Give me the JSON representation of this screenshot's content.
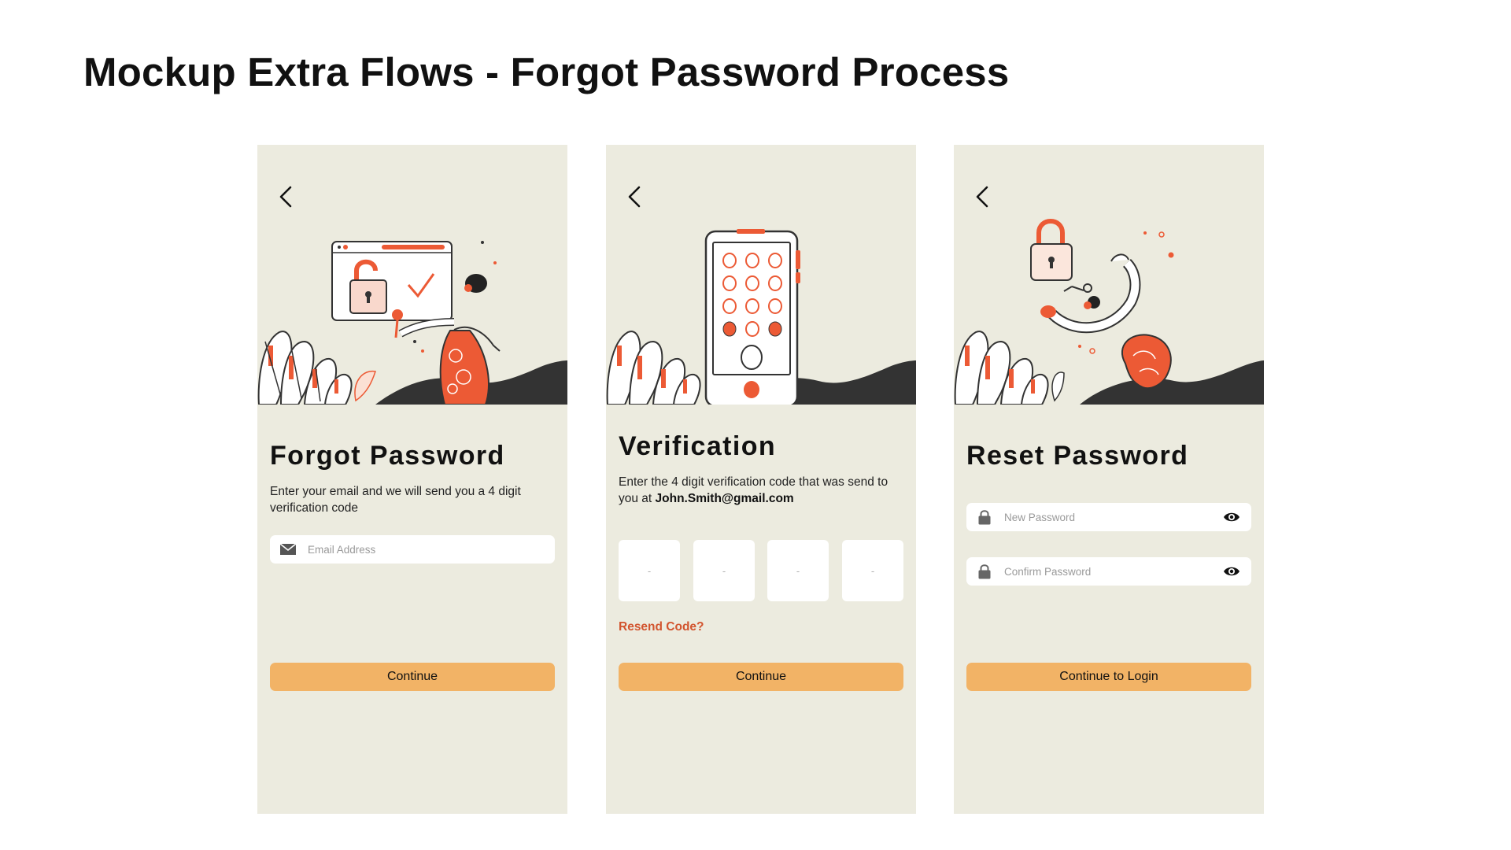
{
  "page": {
    "title": "Mockup Extra Flows - Forgot Password Process"
  },
  "colors": {
    "screen_bg": "#ecebdf",
    "accent": "#ec5a35",
    "button": "#f2b366",
    "ground": "#333333",
    "resend": "#d2542e"
  },
  "screens": [
    {
      "heading": "Forgot Password",
      "description": "Enter your email and we will send you a 4 digit verification code",
      "email_field": {
        "placeholder": "Email Address",
        "value": "",
        "icon": "mail-icon"
      },
      "button": "Continue"
    },
    {
      "heading": "Verification",
      "description_prefix": "Enter the 4 digit verification code that was send to you at ",
      "email": "John.Smith@gmail.com",
      "code_boxes": [
        "-",
        "-",
        "-",
        "-"
      ],
      "resend": "Resend Code?",
      "button": "Continue"
    },
    {
      "heading": "Reset Password",
      "new_password": {
        "placeholder": "New Password",
        "value": "",
        "icon": "lock-icon"
      },
      "confirm_password": {
        "placeholder": "Confirm Password",
        "value": "",
        "icon": "lock-icon"
      },
      "button": "Continue to Login"
    }
  ]
}
